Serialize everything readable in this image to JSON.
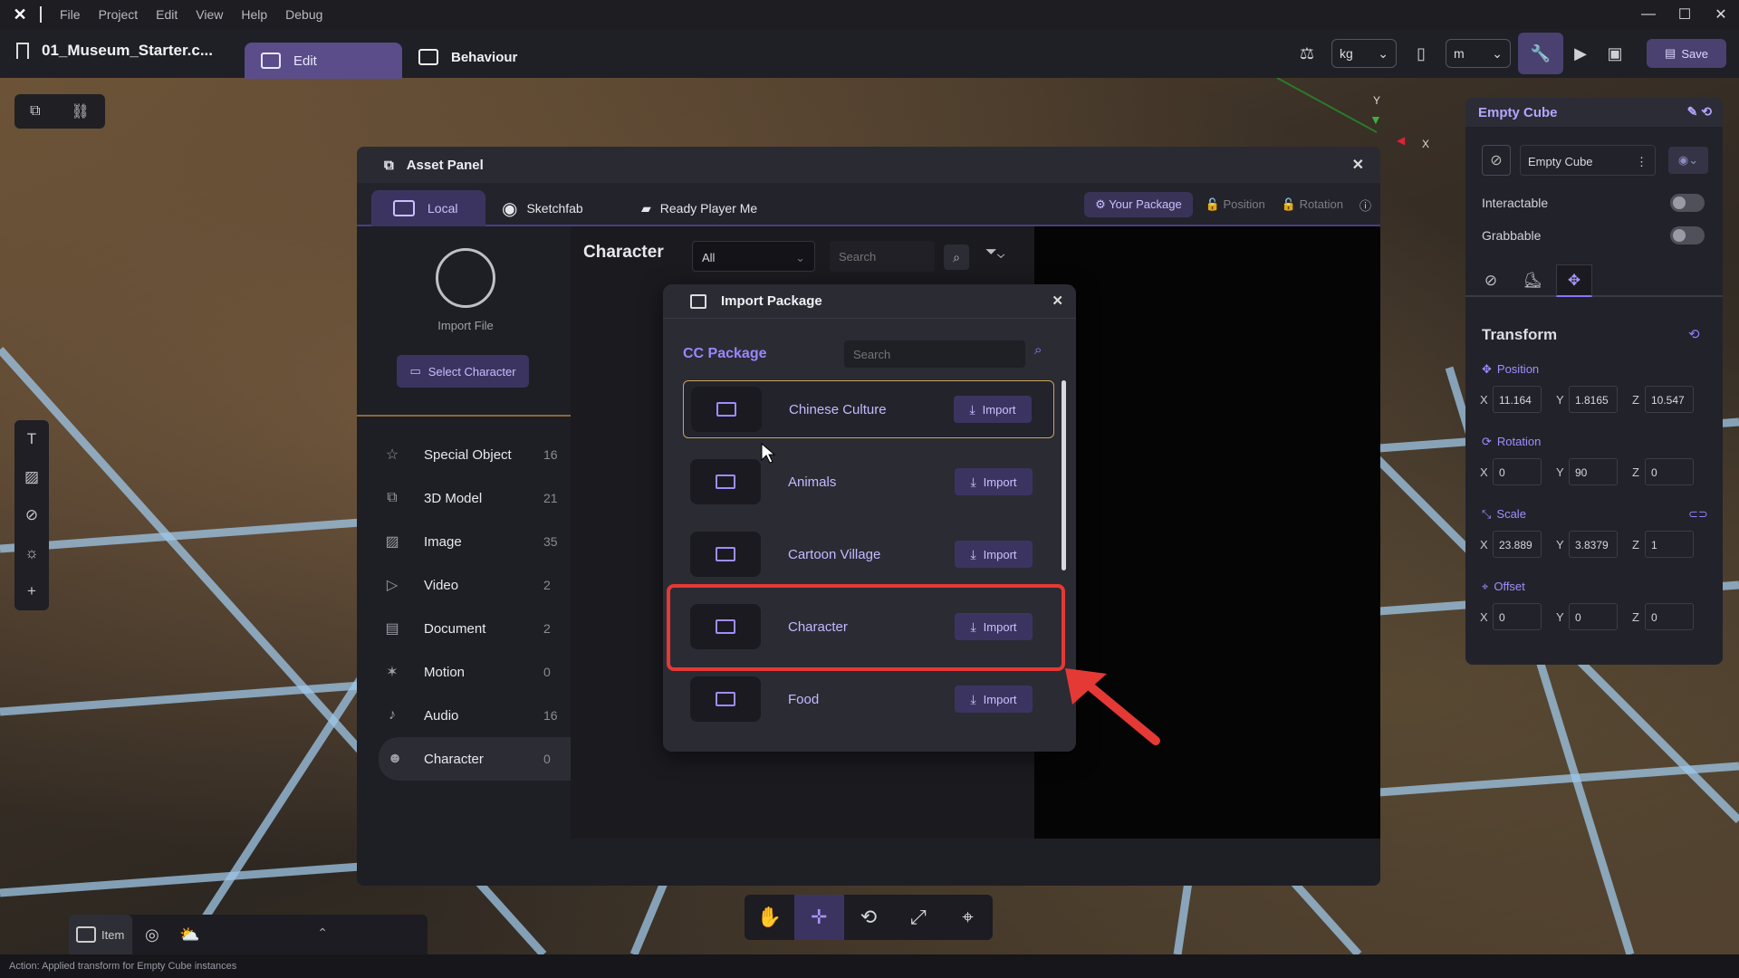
{
  "menubar": {
    "items": [
      "File",
      "Project",
      "Edit",
      "View",
      "Help",
      "Debug"
    ]
  },
  "toolbar": {
    "project_name": "01_Museum_Starter.c...",
    "edit_tab": "Edit",
    "behaviour_tab": "Behaviour",
    "mass_unit": "kg",
    "length_unit": "m",
    "save_label": "Save"
  },
  "asset_panel": {
    "title": "Asset Panel",
    "tabs": [
      "Local",
      "Sketchfab",
      "Ready Player Me"
    ],
    "right_actions": [
      "Your Package",
      "Position",
      "Rotation"
    ],
    "import_file_label": "Import File",
    "select_character_label": "Select Character",
    "categories": [
      {
        "label": "Special Object",
        "count": "16"
      },
      {
        "label": "3D Model",
        "count": "21"
      },
      {
        "label": "Image",
        "count": "35"
      },
      {
        "label": "Video",
        "count": "2"
      },
      {
        "label": "Document",
        "count": "2"
      },
      {
        "label": "Motion",
        "count": "0"
      },
      {
        "label": "Audio",
        "count": "16"
      },
      {
        "label": "Character",
        "count": "0"
      }
    ],
    "main_title": "Character",
    "filter_value": "All",
    "search_placeholder": "Search"
  },
  "import_package": {
    "title": "Import Package",
    "section_title": "CC Package",
    "search_placeholder": "Search",
    "import_label": "Import",
    "packages": [
      "Chinese Culture",
      "Animals",
      "Cartoon Village",
      "Character",
      "Food"
    ]
  },
  "inspector": {
    "title": "Empty Cube",
    "object_name": "Empty Cube",
    "interactable_label": "Interactable",
    "grabbable_label": "Grabbable",
    "transform_title": "Transform",
    "position_label": "Position",
    "rotation_label": "Rotation",
    "scale_label": "Scale",
    "offset_label": "Offset",
    "position": {
      "x": "11.164",
      "y": "1.8165",
      "z": "10.547"
    },
    "rotation": {
      "x": "0",
      "y": "90",
      "z": "0"
    },
    "scale": {
      "x": "23.889",
      "y": "3.8379",
      "z": "1"
    },
    "offset": {
      "x": "0",
      "y": "0",
      "z": "0"
    }
  },
  "bottom": {
    "item_tab": "Item"
  },
  "status": {
    "text": "Action: Applied transform for Empty Cube instances"
  },
  "axis_labels": {
    "y": "Y",
    "x": "X"
  },
  "colors": {
    "accent": "#8a74ff",
    "highlight": "#e53935"
  }
}
